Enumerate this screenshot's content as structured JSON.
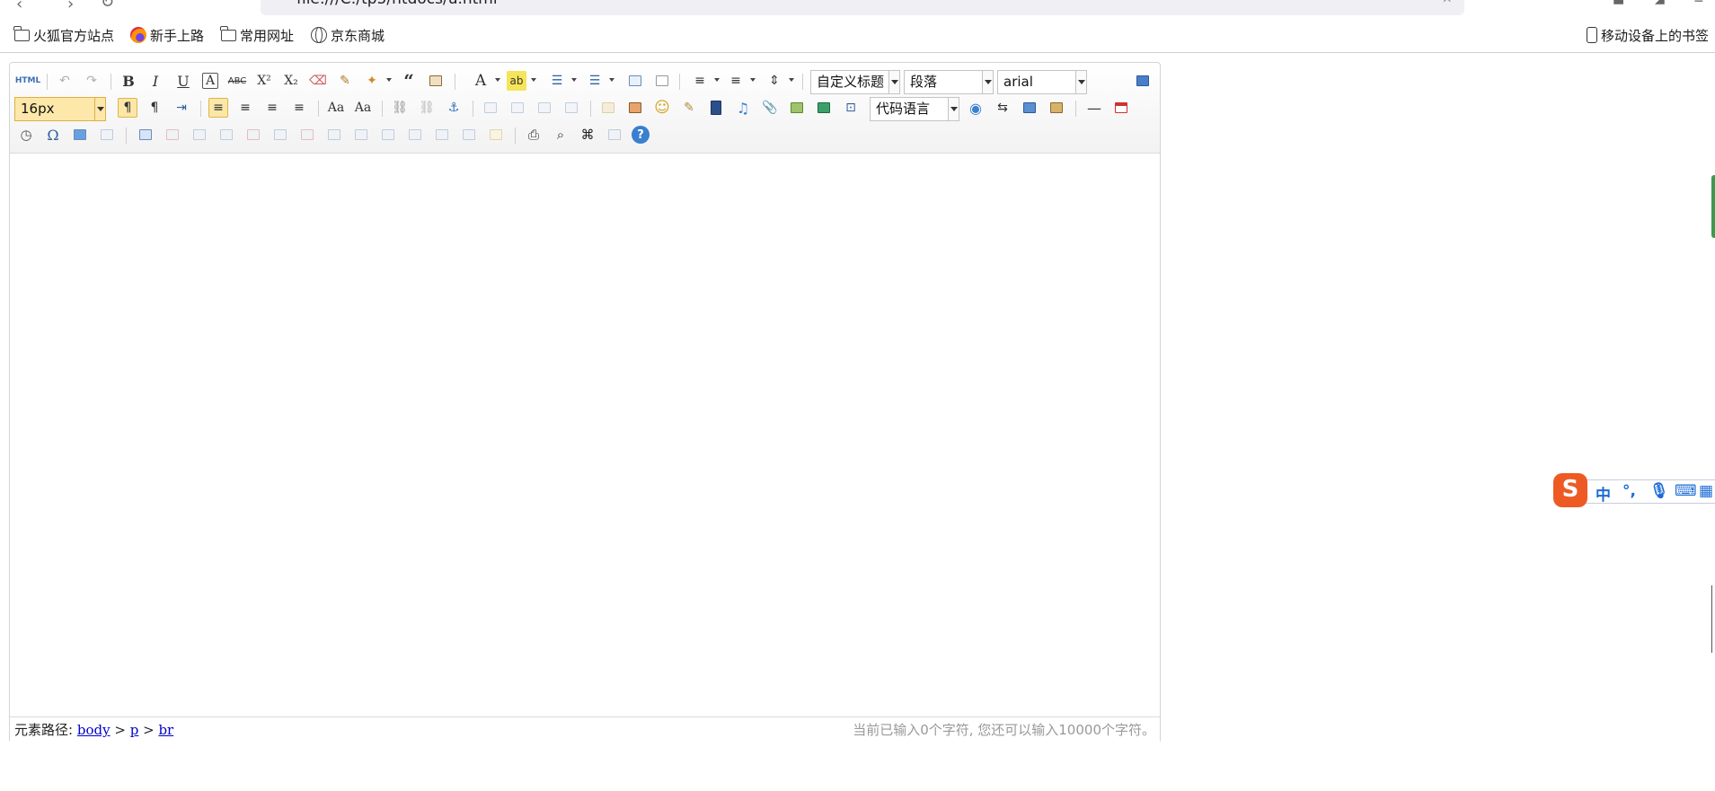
{
  "browser": {
    "url": "file:///C:/tp5/htdocs/u.html",
    "bookmarks": [
      {
        "label": "火狐官方站点",
        "icon": "folder-icon"
      },
      {
        "label": "新手上路",
        "icon": "firefox-icon"
      },
      {
        "label": "常用网址",
        "icon": "folder-icon"
      },
      {
        "label": "京东商城",
        "icon": "globe-icon"
      }
    ],
    "mobile_bookmarks": "移动设备上的书签"
  },
  "toolbar": {
    "html_button": "HTML",
    "custom_title": "自定义标题",
    "paragraph": "段落",
    "font_family": "arial",
    "font_size": "16px",
    "code_language": "代码语言"
  },
  "status": {
    "path_label": "元素路径:",
    "path": [
      "body",
      "p",
      "br"
    ],
    "word_count": "当前已输入0个字符, 您还可以输入10000个字符。"
  },
  "ime": {
    "logo": "S",
    "items": [
      "中",
      "°,"
    ]
  }
}
